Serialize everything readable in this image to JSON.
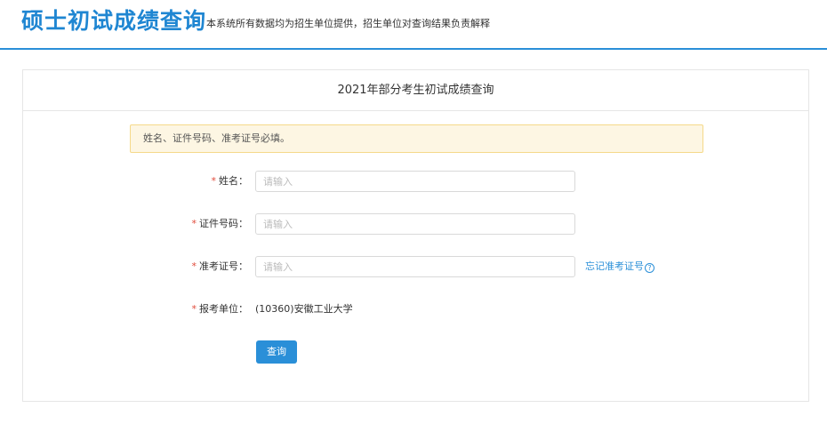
{
  "header": {
    "title": "硕士初试成绩查询",
    "description": "本系统所有数据均为招生单位提供，招生单位对查询结果负责解释"
  },
  "panel": {
    "title": "2021年部分考生初试成绩查询",
    "notice": "姓名、证件号码、准考证号必填。"
  },
  "form": {
    "name": {
      "label": "姓名：",
      "placeholder": "请输入",
      "value": ""
    },
    "id_number": {
      "label": "证件号码：",
      "placeholder": "请输入",
      "value": ""
    },
    "exam_number": {
      "label": "准考证号：",
      "placeholder": "请输入",
      "value": "",
      "forgot_link": "忘记准考证号",
      "help_glyph": "?"
    },
    "unit": {
      "label": "报考单位：",
      "value": "(10360)安徽工业大学"
    },
    "required_mark": "*",
    "submit_label": "查询"
  },
  "colors": {
    "brand": "#1f86d2",
    "button": "#2a8fd8",
    "required": "#e04a3a",
    "notice_bg": "#fdf6e3",
    "notice_border": "#f5d98a"
  }
}
